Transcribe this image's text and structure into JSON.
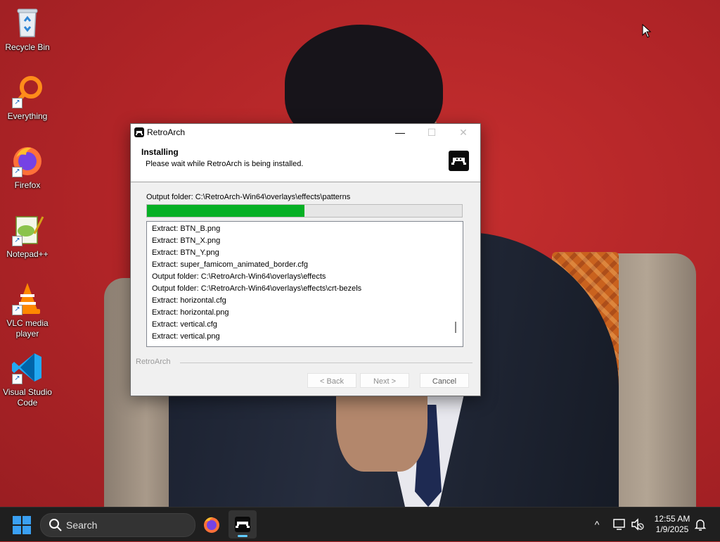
{
  "desktop": {
    "icons": [
      {
        "label": "Recycle Bin",
        "icon": "recycle-bin-icon",
        "shortcut": false
      },
      {
        "label": "Everything",
        "icon": "everything-search-icon",
        "shortcut": true
      },
      {
        "label": "Firefox",
        "icon": "firefox-icon",
        "shortcut": true
      },
      {
        "label": "Notepad++",
        "icon": "notepad-plus-plus-icon",
        "shortcut": true
      },
      {
        "label": "VLC media player",
        "icon": "vlc-icon",
        "shortcut": true
      },
      {
        "label": "Visual Studio Code",
        "icon": "vscode-icon",
        "shortcut": true
      }
    ]
  },
  "window": {
    "title": "RetroArch",
    "controls": {
      "minimize": "—",
      "maximize": "☐",
      "close": "✕"
    },
    "header": {
      "title": "Installing",
      "subtitle": "Please wait while RetroArch is being installed."
    },
    "status": "Output folder: C:\\RetroArch-Win64\\overlays\\effects\\patterns",
    "progress_fraction": 0.5,
    "log": [
      "Extract: BTN_B.png",
      "Extract: BTN_X.png",
      "Extract: BTN_Y.png",
      "Extract: super_famicom_animated_border.cfg",
      "Output folder: C:\\RetroArch-Win64\\overlays\\effects",
      "Output folder: C:\\RetroArch-Win64\\overlays\\effects\\crt-bezels",
      "Extract: horizontal.cfg",
      "Extract: horizontal.png",
      "Extract: vertical.cfg",
      "Extract: vertical.png"
    ],
    "branding": "RetroArch",
    "buttons": {
      "back": "< Back",
      "next": "Next >",
      "cancel": "Cancel"
    }
  },
  "taskbar": {
    "search_label": "Search",
    "pinned": [
      {
        "name": "firefox-taskbar-icon",
        "active": false
      },
      {
        "name": "retroarch-taskbar-icon",
        "active": true
      }
    ],
    "tray": {
      "chevron": "^"
    },
    "clock": {
      "time": "12:55 AM",
      "date": "1/9/2025"
    }
  },
  "colors": {
    "progress": "#06b025",
    "wallpaper": "#b8262a",
    "taskbar": "#1f1f1f",
    "accent": "#60cdff"
  }
}
